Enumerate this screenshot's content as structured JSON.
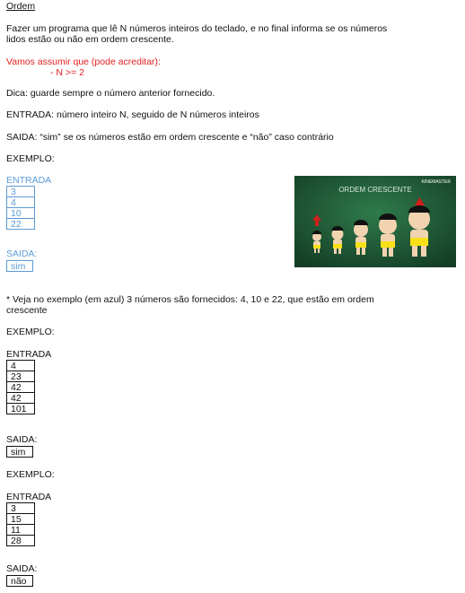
{
  "doc": {
    "title": "Ordem",
    "intro_line1": "Fazer um programa que lê N números inteiros do teclado, e no final informa se os números",
    "intro_line2": "lidos estão ou não em ordem crescente.",
    "assume_line1": "Vamos assumir que (pode acreditar):",
    "assume_line2": "- N >= 2",
    "tip": "Dica: guarde sempre o número anterior fornecido.",
    "input_desc": "ENTRADA: número inteiro N, seguido de N números inteiros",
    "output_desc": "SAIDA: “sim” se os números estão em ordem crescente e “não” caso contrário",
    "note_line1": "* Veja no exemplo (em azul) 3 números são fornecidos: 4, 10 e 22, que estão em ordem",
    "note_line2": "crescente"
  },
  "examples": [
    {
      "label": "EXEMPLO:",
      "input_label": "ENTRADA",
      "inputs": [
        "3",
        "4",
        "10",
        "22"
      ],
      "output_label": "SAIDA:",
      "output": "sim"
    },
    {
      "label": "EXEMPLO:",
      "input_label": "ENTRADA",
      "inputs": [
        "4",
        "23",
        "42",
        "42",
        "101"
      ],
      "output_label": "SAIDA:",
      "output": "sim"
    },
    {
      "label": "EXEMPLO:",
      "input_label": "ENTRADA",
      "inputs": [
        "3",
        "15",
        "11",
        "28"
      ],
      "output_label": "SAIDA:",
      "output": "não"
    }
  ],
  "video": {
    "caption": "ORDEM CRESCENTE",
    "watermark": "KINEMASTER",
    "background": "#1e5a36"
  },
  "colors": {
    "red": "#e02020",
    "blue": "#5b9bd5"
  }
}
